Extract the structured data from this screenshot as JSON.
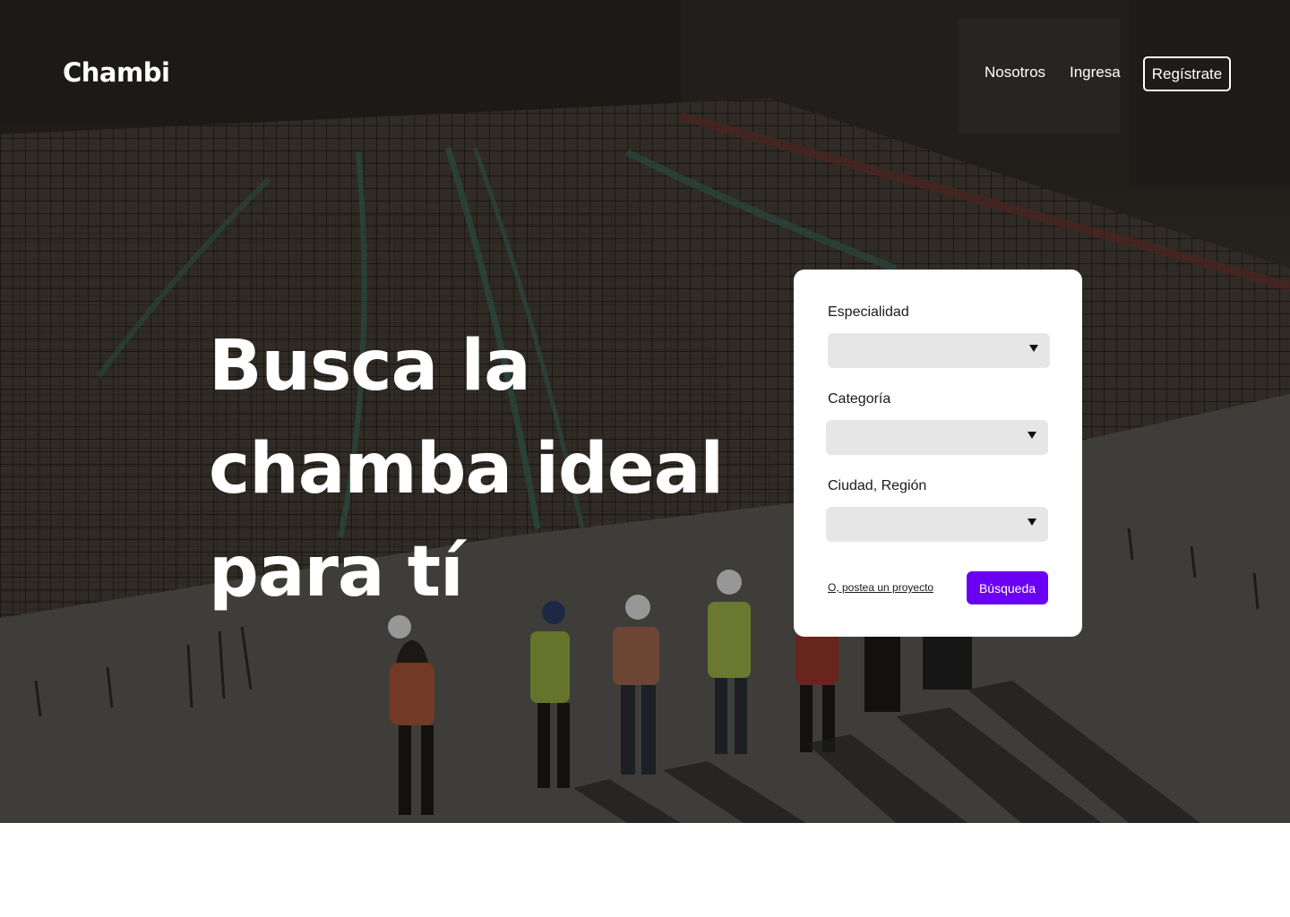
{
  "brand": {
    "logo": "Chambi"
  },
  "nav": {
    "about": "Nosotros",
    "login": "Ingresa",
    "register": "Regístrate"
  },
  "hero": {
    "headline_lines": [
      "Busca la",
      "chamba ideal",
      "para tí"
    ]
  },
  "search_form": {
    "specialty": {
      "label": "Especialidad",
      "value": ""
    },
    "category": {
      "label": "Categoría",
      "value": ""
    },
    "location": {
      "label": "Ciudad, Región",
      "value": ""
    },
    "post_project_link": "O, postea un proyecto",
    "search_button": "Búsqueda"
  },
  "colors": {
    "accent": "#6a00f4",
    "card_background": "#ffffff",
    "select_background": "#e6e6e6"
  },
  "icons": {
    "dropdown": "caret-down-icon"
  }
}
